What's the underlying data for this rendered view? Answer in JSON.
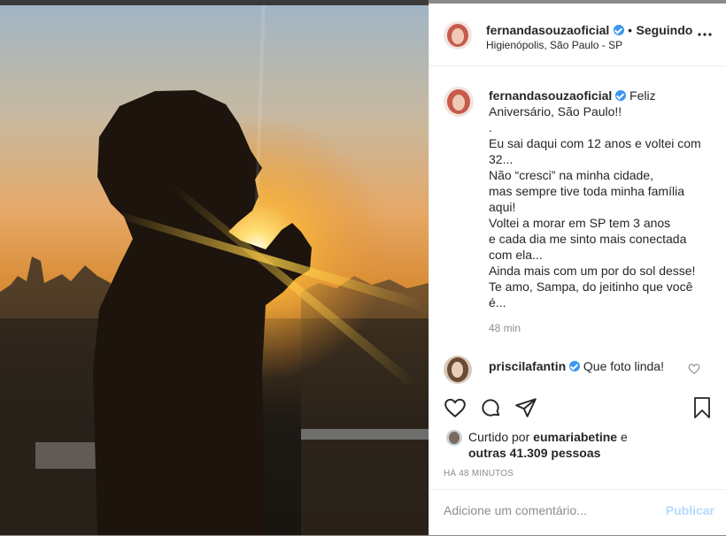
{
  "post": {
    "header": {
      "username": "fernandasouzaoficial",
      "separator": "•",
      "follow_status": "Seguindo",
      "location": "Higienópolis, São Paulo - SP"
    },
    "caption": {
      "username": "fernandasouzaoficial",
      "lines": [
        "Feliz",
        "Aniversário, São Paulo!!",
        ".",
        "Eu sai daqui com 12 anos e voltei com",
        "32...",
        "Não “cresci” na minha cidade,",
        "mas sempre tive toda minha família",
        "aqui!",
        "Voltei a morar em SP tem 3 anos",
        "e cada dia me sinto mais conectada",
        "com ela...",
        "Ainda mais com um por do sol desse!",
        "Te amo, Sampa, do jeitinho que você",
        "é..."
      ],
      "time": "48 min"
    },
    "comment": {
      "username": "priscilafantin",
      "text": "Que foto linda!"
    },
    "likes": {
      "prefix": "Curtido por",
      "liker": "eumariabetine",
      "conjunction": "e",
      "others": "outras 41.309 pessoas"
    },
    "timestamp": "HÁ 48 MINUTOS",
    "add_comment": {
      "placeholder": "Adicione um comentário...",
      "publish_label": "Publicar"
    },
    "icons": {
      "more": "more-options-icon",
      "like": "heart-icon",
      "comment": "comment-icon",
      "share": "share-icon",
      "save": "bookmark-icon"
    },
    "colors": {
      "verified": "#3897f0",
      "text": "#262626",
      "muted": "#8e8e8e",
      "publish_disabled": "#b3dbff"
    }
  }
}
